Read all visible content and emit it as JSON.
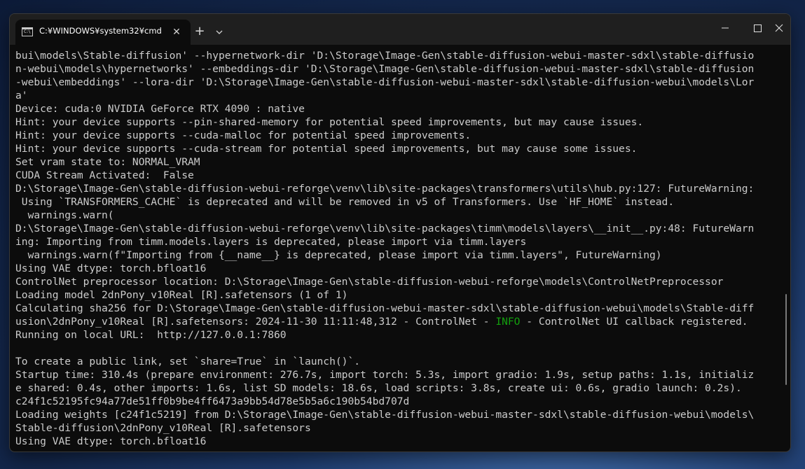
{
  "window": {
    "tab_title": "C:¥WINDOWS¥system32¥cmd",
    "tab_icon_text": "C:\\",
    "new_tab_symbol": "+",
    "close_tab_symbol": "✕"
  },
  "terminal": {
    "lines": [
      "bui\\models\\Stable-diffusion' --hypernetwork-dir 'D:\\Storage\\Image-Gen\\stable-diffusion-webui-master-sdxl\\stable-diffusio",
      "n-webui\\models\\hypernetworks' --embeddings-dir 'D:\\Storage\\Image-Gen\\stable-diffusion-webui-master-sdxl\\stable-diffusion",
      "-webui\\embeddings' --lora-dir 'D:\\Storage\\Image-Gen\\stable-diffusion-webui-master-sdxl\\stable-diffusion-webui\\models\\Lor",
      "a'",
      "Device: cuda:0 NVIDIA GeForce RTX 4090 : native",
      "Hint: your device supports --pin-shared-memory for potential speed improvements, but may cause issues.",
      "Hint: your device supports --cuda-malloc for potential speed improvements.",
      "Hint: your device supports --cuda-stream for potential speed improvements, but may cause some issues.",
      "Set vram state to: NORMAL_VRAM",
      "CUDA Stream Activated:  False",
      "D:\\Storage\\Image-Gen\\stable-diffusion-webui-reforge\\venv\\lib\\site-packages\\transformers\\utils\\hub.py:127: FutureWarning:",
      " Using `TRANSFORMERS_CACHE` is deprecated and will be removed in v5 of Transformers. Use `HF_HOME` instead.",
      "  warnings.warn(",
      "D:\\Storage\\Image-Gen\\stable-diffusion-webui-reforge\\venv\\lib\\site-packages\\timm\\models\\layers\\__init__.py:48: FutureWarn",
      "ing: Importing from timm.models.layers is deprecated, please import via timm.layers",
      "  warnings.warn(f\"Importing from {__name__} is deprecated, please import via timm.layers\", FutureWarning)",
      "Using VAE dtype: torch.bfloat16",
      "ControlNet preprocessor location: D:\\Storage\\Image-Gen\\stable-diffusion-webui-reforge\\models\\ControlNetPreprocessor",
      "Loading model 2dnPony_v10Real [R].safetensors (1 of 1)",
      "Calculating sha256 for D:\\Storage\\Image-Gen\\stable-diffusion-webui-master-sdxl\\stable-diffusion-webui\\models\\Stable-diff"
    ],
    "line_info_prefix": "usion\\2dnPony_v10Real [R].safetensors: 2024-11-30 11:11:48,312 - ControlNet - ",
    "line_info_level": "INFO",
    "line_info_suffix": " - ControlNet UI callback registered.",
    "lines_after": [
      "Running on local URL:  http://127.0.0.1:7860",
      "",
      "To create a public link, set `share=True` in `launch()`.",
      "Startup time: 310.4s (prepare environment: 276.7s, import torch: 5.3s, import gradio: 1.9s, setup paths: 1.1s, initializ",
      "e shared: 0.4s, other imports: 1.6s, list SD models: 18.6s, load scripts: 3.8s, create ui: 0.6s, gradio launch: 0.2s).",
      "c24f1c52195fc94a77de51ff0b9be4ff6473a9bb54d78e5b5a6c190b54bd707d",
      "Loading weights [c24f1c5219] from D:\\Storage\\Image-Gen\\stable-diffusion-webui-master-sdxl\\stable-diffusion-webui\\models\\",
      "Stable-diffusion\\2dnPony_v10Real [R].safetensors",
      "Using VAE dtype: torch.bfloat16"
    ]
  },
  "colors": {
    "terminal_bg": "#0c0c0c",
    "terminal_fg": "#cccccc",
    "info_green": "#13a10e",
    "titlebar_bg": "#1f1f1f"
  }
}
